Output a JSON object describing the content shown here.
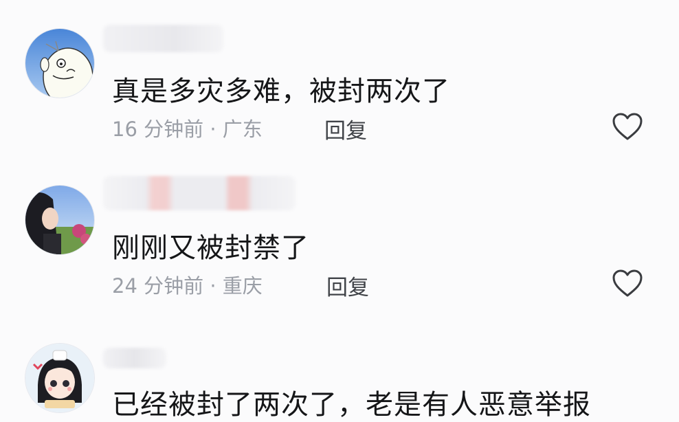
{
  "comments": [
    {
      "text": "真是多灾多难，被封两次了",
      "meta": "16 分钟前 · 广东",
      "reply_label": "回复"
    },
    {
      "text": "刚刚又被封禁了",
      "meta": "24 分钟前 · 重庆",
      "reply_label": "回复"
    },
    {
      "text": "已经被封了两次了，老是有人恶意举报"
    }
  ],
  "icons": {
    "like": "heart-outline-icon"
  },
  "colors": {
    "comment_text": "#151618",
    "meta_text": "#9a9ea6",
    "reply_text": "#404348",
    "heart_stroke": "#3a3c40"
  }
}
